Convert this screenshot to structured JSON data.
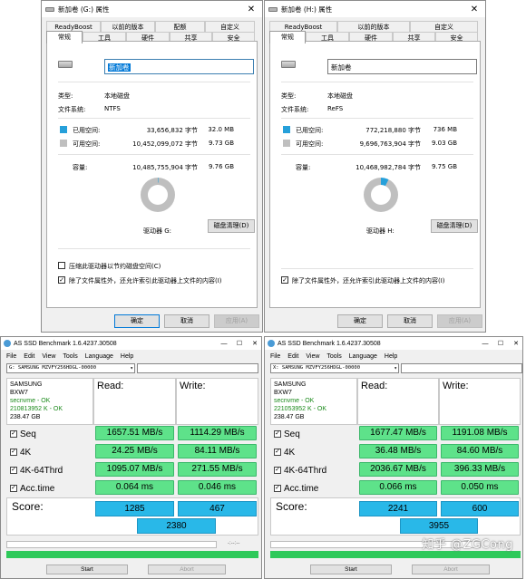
{
  "left_props": {
    "title": "新加卷 (G:) 属性",
    "tabs_top": [
      "ReadyBoost",
      "以前的版本",
      "配额",
      "自定义"
    ],
    "tabs_bottom": [
      "常规",
      "工具",
      "硬件",
      "共享",
      "安全"
    ],
    "volume_name": "新加卷",
    "type_label": "类型:",
    "type_value": "本地磁盘",
    "fs_label": "文件系统:",
    "fs_value": "NTFS",
    "used_label": "已用空间:",
    "used_bytes": "33,656,832 字节",
    "used_size": "32.0 MB",
    "free_label": "可用空间:",
    "free_bytes": "10,452,099,072 字节",
    "free_size": "9.73 GB",
    "cap_label": "容量:",
    "cap_bytes": "10,485,755,904 字节",
    "cap_size": "9.76 GB",
    "drive_label": "驱动器 G:",
    "cleanup_button": "磁盘清理(D)",
    "compress_label": "压缩此驱动器以节约磁盘空间(C)",
    "index_label": "除了文件属性外，还允许索引此驱动器上文件的内容(I)",
    "ok_button": "确定",
    "cancel_button": "取消",
    "apply_button": "应用(A)",
    "used_fraction": 0.003
  },
  "right_props": {
    "title": "新加卷 (H:) 属性",
    "tabs_top": [
      "ReadyBoost",
      "以前的版本",
      "自定义"
    ],
    "tabs_bottom": [
      "常规",
      "工具",
      "硬件",
      "共享",
      "安全"
    ],
    "volume_name": "新加卷",
    "type_label": "类型:",
    "type_value": "本地磁盘",
    "fs_label": "文件系统:",
    "fs_value": "ReFS",
    "used_label": "已用空间:",
    "used_bytes": "772,218,880 字节",
    "used_size": "736 MB",
    "free_label": "可用空间:",
    "free_bytes": "9,696,763,904 字节",
    "free_size": "9.03 GB",
    "cap_label": "容量:",
    "cap_bytes": "10,468,982,784 字节",
    "cap_size": "9.75 GB",
    "drive_label": "驱动器 H:",
    "cleanup_button": "磁盘清理(D)",
    "index_label": "除了文件属性外，还允许索引此驱动器上文件的内容(I)",
    "ok_button": "确定",
    "cancel_button": "取消",
    "apply_button": "应用(A)",
    "used_fraction": 0.074
  },
  "left_ssd": {
    "title": "AS SSD Benchmark 1.6.4237.30508",
    "menu": [
      "File",
      "Edit",
      "View",
      "Tools",
      "Language",
      "Help"
    ],
    "device": "G: SAMSUNG MZVFY256HDGL-00000",
    "info": [
      "SAMSUNG",
      "BXW7",
      "secnvme - OK",
      "210813952 K - OK",
      "238.47 GB"
    ],
    "read_header": "Read:",
    "write_header": "Write:",
    "rows": [
      {
        "label": "Seq",
        "read": "1657.51 MB/s",
        "write": "1114.29 MB/s"
      },
      {
        "label": "4K",
        "read": "24.25 MB/s",
        "write": "84.11 MB/s"
      },
      {
        "label": "4K-64Thrd",
        "read": "1095.07 MB/s",
        "write": "271.55 MB/s"
      },
      {
        "label": "Acc.time",
        "read": "0.064 ms",
        "write": "0.046 ms"
      }
    ],
    "score_label": "Score:",
    "score_read": "1285",
    "score_write": "467",
    "score_total": "2380",
    "dashes": "-:--:--",
    "start_button": "Start",
    "abort_button": "Abort"
  },
  "right_ssd": {
    "title": "AS SSD Benchmark 1.6.4237.30508",
    "menu": [
      "File",
      "Edit",
      "View",
      "Tools",
      "Language",
      "Help"
    ],
    "device": "X: SAMSUNG MZVFY256HDGL-00000",
    "info": [
      "SAMSUNG",
      "BXW7",
      "secnvme - OK",
      "221053952 K - OK",
      "238.47 GB"
    ],
    "read_header": "Read:",
    "write_header": "Write:",
    "rows": [
      {
        "label": "Seq",
        "read": "1677.47 MB/s",
        "write": "1191.08 MB/s"
      },
      {
        "label": "4K",
        "read": "36.48 MB/s",
        "write": "84.60 MB/s"
      },
      {
        "label": "4K-64Thrd",
        "read": "2036.67 MB/s",
        "write": "396.33 MB/s"
      },
      {
        "label": "Acc.time",
        "read": "0.066 ms",
        "write": "0.050 ms"
      }
    ],
    "score_label": "Score:",
    "score_read": "2241",
    "score_write": "600",
    "score_total": "3955",
    "dashes": "-:--:--",
    "start_button": "Start",
    "abort_button": "Abort"
  },
  "watermark": "知乎 @ZGCong",
  "colors": {
    "used": "#26a0da",
    "free": "#bfbfbf",
    "result": "#5ee28a",
    "score": "#29b8e8"
  }
}
